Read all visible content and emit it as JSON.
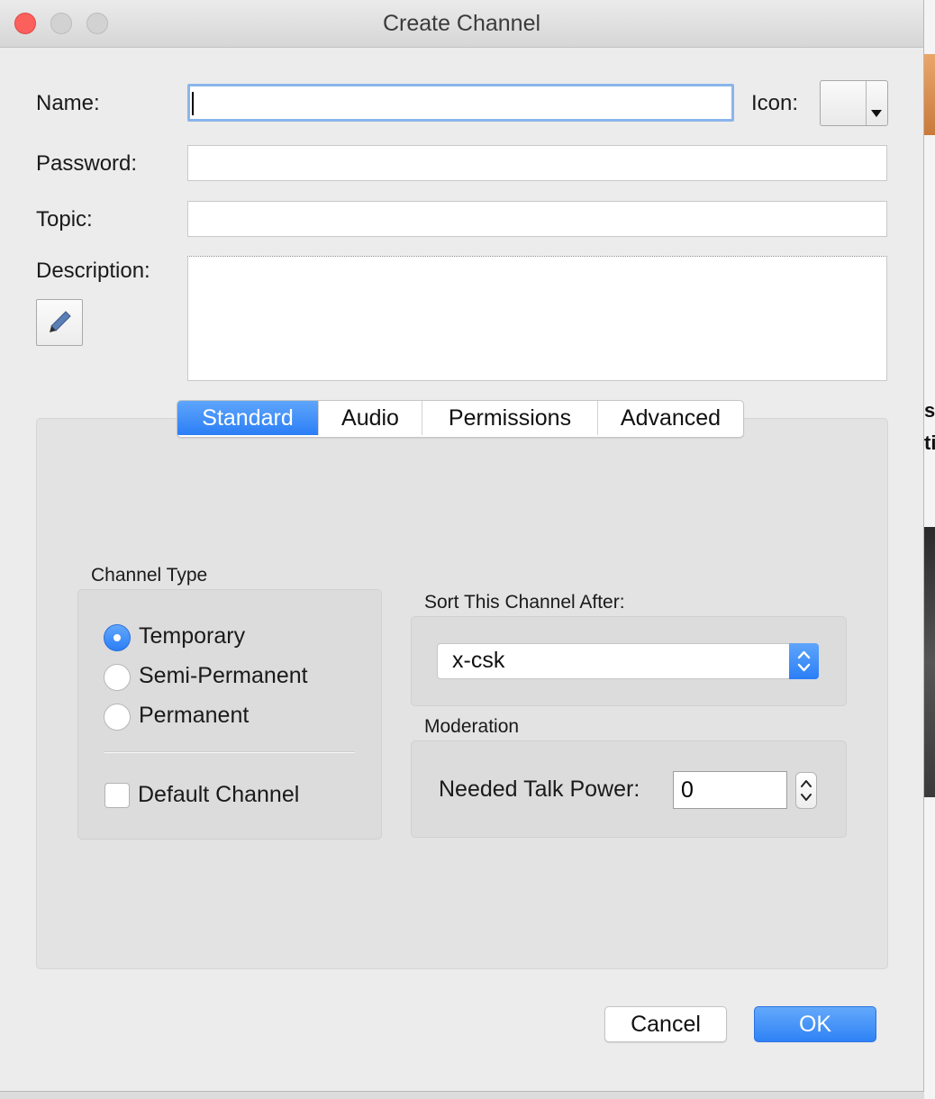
{
  "window": {
    "title": "Create Channel"
  },
  "fields": {
    "name_label": "Name:",
    "name_value": "",
    "icon_label": "Icon:",
    "password_label": "Password:",
    "password_value": "",
    "topic_label": "Topic:",
    "topic_value": "",
    "description_label": "Description:",
    "description_value": ""
  },
  "tabs": [
    {
      "label": "Standard",
      "active": true
    },
    {
      "label": "Audio",
      "active": false
    },
    {
      "label": "Permissions",
      "active": false
    },
    {
      "label": "Advanced",
      "active": false
    }
  ],
  "channel_type": {
    "title": "Channel Type",
    "options": [
      {
        "label": "Temporary",
        "selected": true
      },
      {
        "label": "Semi-Permanent",
        "selected": false
      },
      {
        "label": "Permanent",
        "selected": false
      }
    ],
    "default_channel_label": "Default Channel",
    "default_channel_checked": false
  },
  "sort": {
    "title": "Sort This Channel After:",
    "selected": "x-csk"
  },
  "moderation": {
    "title": "Moderation",
    "talk_power_label": "Needed Talk Power:",
    "talk_power_value": "0"
  },
  "buttons": {
    "cancel": "Cancel",
    "ok": "OK"
  },
  "background_app": {
    "text_line1": "s",
    "text_line2": "ti"
  },
  "colors": {
    "accent": "#2b7ef6",
    "close": "#fc605c"
  },
  "icons": {
    "edit": "pencil-icon",
    "dropdown": "dropdown-arrow-icon",
    "stepper": "up-down-chevron-icon"
  }
}
